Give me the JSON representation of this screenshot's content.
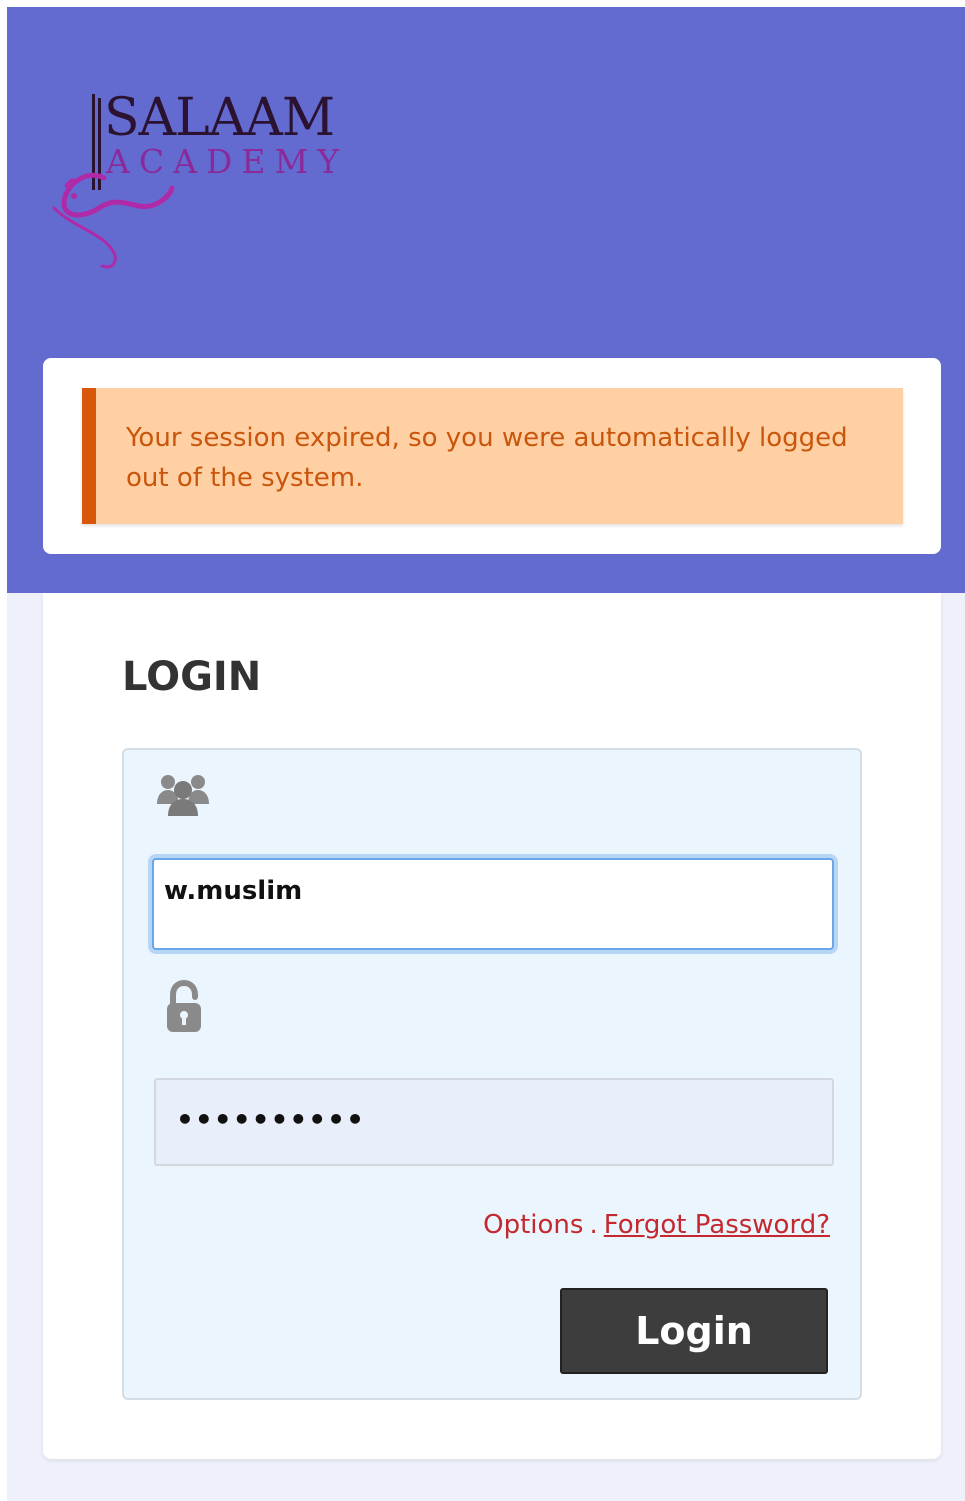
{
  "brand": {
    "name": "SALAAM",
    "subtitle": "ACADEMY"
  },
  "colors": {
    "header": "#636bd1",
    "alert_background": "#ffd0a3",
    "alert_accent": "#d9570b",
    "link": "#c5282e",
    "button": "#3d3d3d"
  },
  "alert": {
    "message": "Your session expired, so you were automatically logged out of the system."
  },
  "login": {
    "title": "LOGIN",
    "username_icon": "users-icon",
    "username_value": "w.muslim",
    "password_icon": "lock-icon",
    "password_value": "••••••••••",
    "options_label": "Options",
    "separator": ".",
    "forgot_label": "Forgot Password?",
    "button_label": "Login"
  }
}
